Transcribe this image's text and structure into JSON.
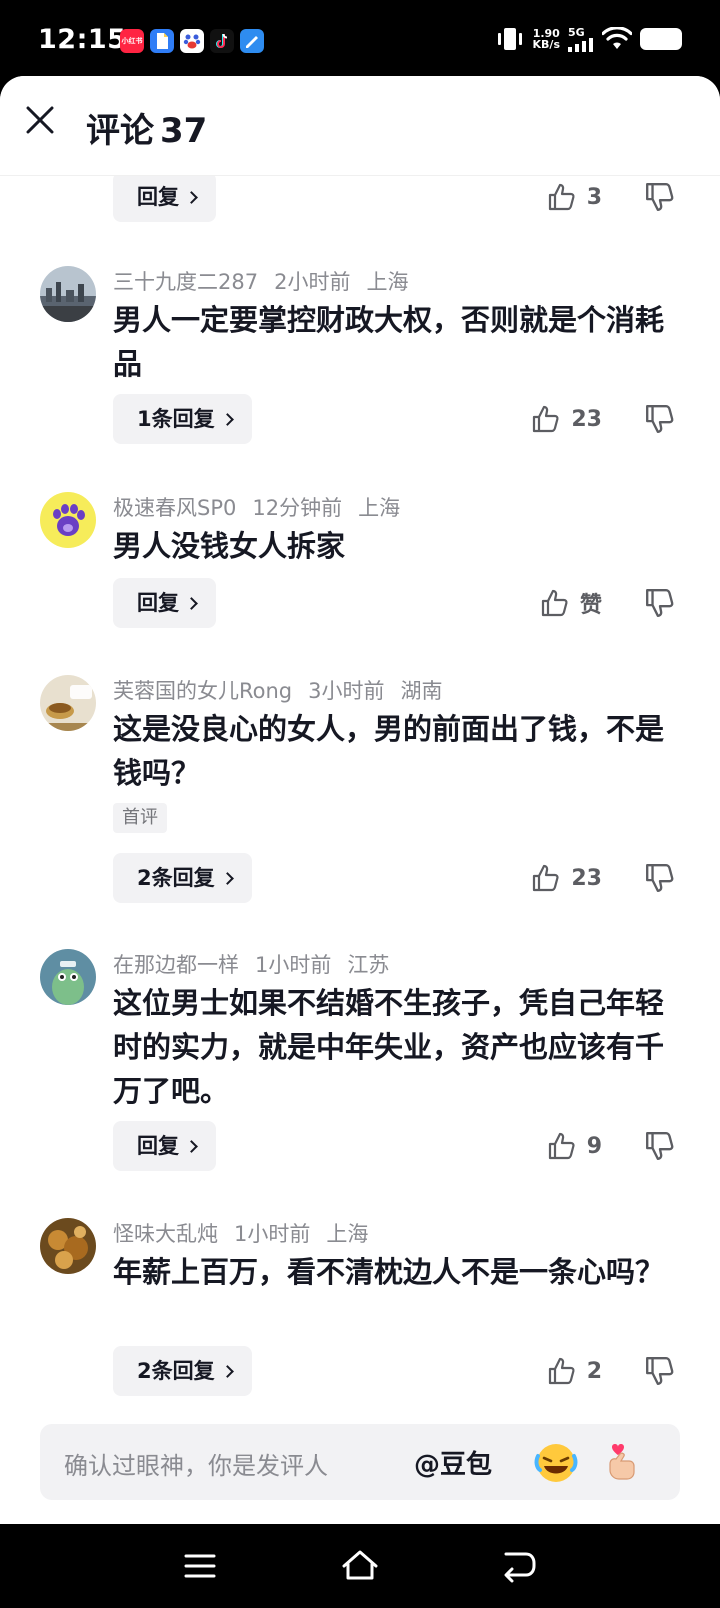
{
  "status_bar": {
    "time": "12:15",
    "apps": [
      {
        "name": "xiaohongshu-app-icon",
        "label": "小红书",
        "color": "#ff2442"
      },
      {
        "name": "docs-app-icon",
        "label": "",
        "color": "#2f7df6"
      },
      {
        "name": "baidu-app-icon",
        "label": "",
        "color": "#3a5cdb"
      },
      {
        "name": "tiktok-app-icon",
        "label": "",
        "color": "#111111"
      },
      {
        "name": "notes-app-icon",
        "label": "",
        "color": "#2e8cf0"
      }
    ],
    "speed_value": "1.90",
    "speed_unit": "KB/s",
    "network": "5G"
  },
  "header": {
    "title": "评论",
    "count": "37"
  },
  "comments": [
    {
      "reply_label": "回复",
      "likes": "3"
    },
    {
      "username": "三十九度二287",
      "time": "2小时前",
      "location": "上海",
      "text": "男人一定要掌控财政大权，否则就是个消耗品",
      "reply_label": "1条回复",
      "likes": "23",
      "avatar": "city-skyline-avatar"
    },
    {
      "username": "极速春风SP0",
      "time": "12分钟前",
      "location": "上海",
      "text": "男人没钱女人拆家",
      "reply_label": "回复",
      "likes": "赞",
      "avatar": "cat-paw-avatar"
    },
    {
      "username": "芙蓉国的女儿Rong",
      "time": "3小时前",
      "location": "湖南",
      "text": "这是没良心的女人，男的前面出了钱，不是钱吗？",
      "tag": "首评",
      "reply_label": "2条回复",
      "likes": "23",
      "avatar": "tea-avatar"
    },
    {
      "username": "在那边都一样",
      "time": "1小时前",
      "location": "江苏",
      "text": "这位男士如果不结婚不生孩子，凭自己年轻时的实力，就是中年失业，资产也应该有千万了吧。",
      "reply_label": "回复",
      "likes": "9",
      "avatar": "cartoon-avatar"
    },
    {
      "username": "怪味大乱炖",
      "time": "1小时前",
      "location": "上海",
      "text": "年薪上百万，看不清枕边人不是一条心吗？",
      "reply_label": "2条回复",
      "likes": "2",
      "avatar": "food-avatar"
    }
  ],
  "input": {
    "placeholder": "确认过眼神，你是发评人",
    "mention": "@豆包"
  },
  "colors": {
    "background": "#ffffff",
    "text": "#161823",
    "meta": "#8a8b91",
    "chip": "#f2f2f4"
  }
}
